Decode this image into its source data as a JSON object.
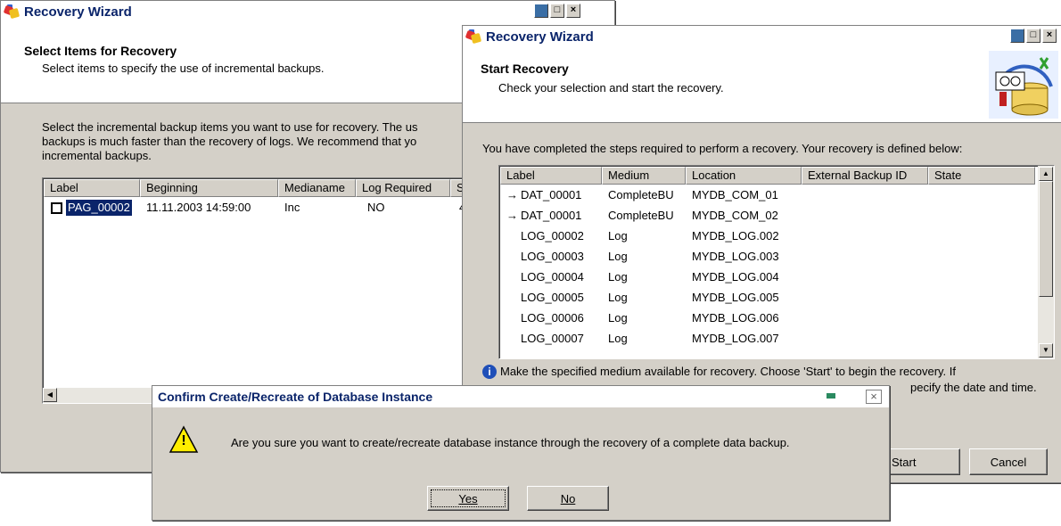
{
  "back_window": {
    "title": "Recovery Wizard",
    "header_title": "Select Items for Recovery",
    "header_subtitle": "Select items to specify the use of incremental backups.",
    "intro_line1": "Select the incremental backup items you want to use for recovery. The us",
    "intro_line2": "backups is much faster than the recovery of logs. We recommend that yo",
    "intro_line3": "incremental backups.",
    "columns": [
      "Label",
      "Beginning",
      "Medianame",
      "Log Required",
      "S"
    ],
    "row": {
      "label": "PAG_00002",
      "beginning": "11.11.2003 14:59:00",
      "medianame": "Inc",
      "log_required": "NO",
      "extra": "4",
      "checked": false
    }
  },
  "front_window": {
    "title": "Recovery Wizard",
    "header_title": "Start Recovery",
    "header_subtitle": "Check your selection and start the recovery.",
    "intro": "You have completed the steps required to perform a recovery. Your recovery is defined below:",
    "columns": [
      "Label",
      "Medium",
      "Location",
      "External Backup ID",
      "State"
    ],
    "rows": [
      {
        "arrow": "→",
        "label": "DAT_00001",
        "medium": "CompleteBU",
        "location": "MYDB_COM_01"
      },
      {
        "arrow": "→",
        "label": "DAT_00001",
        "medium": "CompleteBU",
        "location": "MYDB_COM_02"
      },
      {
        "arrow": "",
        "label": "LOG_00002",
        "medium": "Log",
        "location": "MYDB_LOG.002"
      },
      {
        "arrow": "",
        "label": "LOG_00003",
        "medium": "Log",
        "location": "MYDB_LOG.003"
      },
      {
        "arrow": "",
        "label": "LOG_00004",
        "medium": "Log",
        "location": "MYDB_LOG.004"
      },
      {
        "arrow": "",
        "label": "LOG_00005",
        "medium": "Log",
        "location": "MYDB_LOG.005"
      },
      {
        "arrow": "",
        "label": "LOG_00006",
        "medium": "Log",
        "location": "MYDB_LOG.006"
      },
      {
        "arrow": "",
        "label": "LOG_00007",
        "medium": "Log",
        "location": "MYDB_LOG.007"
      }
    ],
    "info_line1": "Make the specified medium available for recovery. Choose 'Start' to begin the recovery. If",
    "info_line2": "pecify the date and time.",
    "start_label": "Start",
    "cancel_label": "Cancel"
  },
  "dialog": {
    "title": "Confirm Create/Recreate of Database Instance",
    "message": "Are you sure you want to create/recreate database instance through the recovery of a complete data backup.",
    "yes_label": "Yes",
    "no_label": "No",
    "warning_glyph": "!"
  }
}
